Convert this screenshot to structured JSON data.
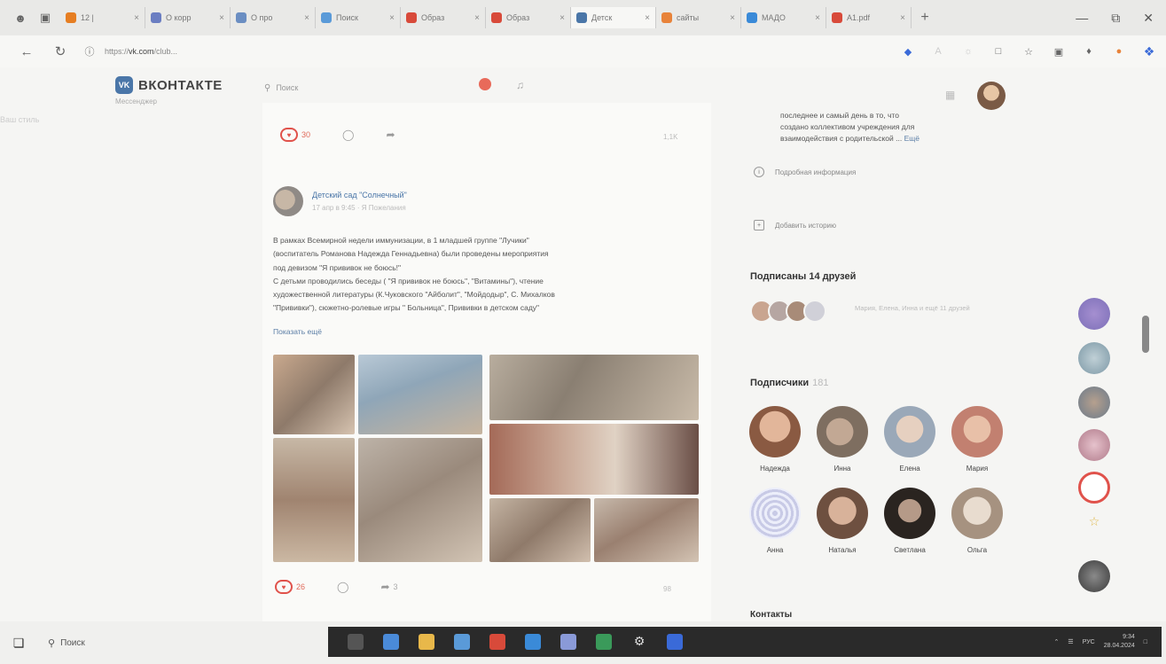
{
  "browser": {
    "tabs": [
      {
        "label": "12 | ",
        "color": "#e67e22"
      },
      {
        "label": "О корр",
        "color": "#6b7ec2"
      },
      {
        "label": "О про",
        "color": "#6b8ec2"
      },
      {
        "label": "Поиск",
        "color": "#5a9ad8"
      },
      {
        "label": "Образ",
        "color": "#d84a3a"
      },
      {
        "label": "Образ",
        "color": "#d84a3a"
      },
      {
        "label": "Детск",
        "color": "#4a76a8"
      },
      {
        "label": "сайты",
        "color": "#e8833a"
      },
      {
        "label": "МАДО",
        "color": "#3a8ad8"
      },
      {
        "label": "А1.pdf",
        "color": "#d84a3a"
      }
    ],
    "url_prefix": "https://",
    "url_domain": "vk.com",
    "url_path": "/club..."
  },
  "header": {
    "logo_text": "ВКОНТАКТЕ",
    "logo_sub": "Мессенджер",
    "search_placeholder": "Поиск",
    "left_faded": "Ваш стиль"
  },
  "feed": {
    "top_reactions": {
      "likes": "30",
      "views": "1,1K"
    },
    "post": {
      "author": "Детский сад \"Солнечный\"",
      "date": "17 апр в 9:45 · Я  Пожелания",
      "text_lines": [
        "В рамках Всемирной недели иммунизации, в 1 младшей группе \"Лучики\"",
        "(воспитатель Романова Надежда Геннадьевна) были проведены мероприятия",
        "под девизом \"Я прививок не боюсь!\"",
        "С детьми проводились беседы ( \"Я прививок не боюсь\", \"Витамины\"), чтение",
        "художественной литературы (К.Чуковского \"Айболит\", \"Мойдодыр\", С. Михалков",
        "\"Прививки\"), сюжетно-ролевые игры \" Больница\", Прививки в детском саду\""
      ],
      "show_more": "Показать ещё",
      "likes": "26",
      "reposts": "3",
      "views": "98"
    }
  },
  "sidebar": {
    "info_lines": [
      "последнее и самый день в то, что",
      "создано коллективом учреждения для",
      "взаимодействия с родительской ..."
    ],
    "info_more": "Ещё",
    "detail_link": "Подробная информация",
    "add_story": "Добавить историю",
    "friends_title": "Подписаны 14 друзей",
    "friend_names": "Мария, Елена, Инна и ещё 11 друзей",
    "followers_title": "Подписчики",
    "followers_count": "181",
    "followers": [
      {
        "name": "Надежда"
      },
      {
        "name": "Инна"
      },
      {
        "name": "Елена"
      },
      {
        "name": "Мария"
      },
      {
        "name": "Анна"
      },
      {
        "name": "Наталья"
      },
      {
        "name": "Светлана"
      },
      {
        "name": "Ольга"
      }
    ],
    "contacts_title": "Контакты"
  },
  "taskbar": {
    "search_label": "Поиск",
    "lang": "РУС",
    "time": "9:34",
    "date": "28.04.2024"
  }
}
